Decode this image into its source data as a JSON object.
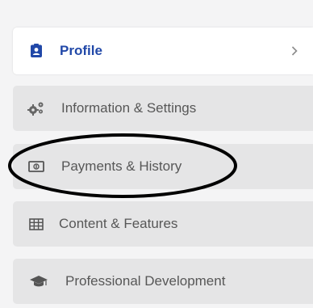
{
  "menu": {
    "items": [
      {
        "label": "Profile",
        "icon": "id-badge-icon",
        "active": true
      },
      {
        "label": "Information & Settings",
        "icon": "gears-icon",
        "active": false
      },
      {
        "label": "Payments & History",
        "icon": "money-bill-icon",
        "active": false
      },
      {
        "label": "Content & Features",
        "icon": "table-icon",
        "active": false
      },
      {
        "label": "Professional Development",
        "icon": "graduation-cap-icon",
        "active": false
      }
    ],
    "chevron": ">"
  },
  "colors": {
    "active_text": "#2148a8",
    "inactive_text": "#575757",
    "inactive_bg": "#e5e5e6",
    "active_bg": "#ffffff",
    "annotation": "#000000"
  }
}
